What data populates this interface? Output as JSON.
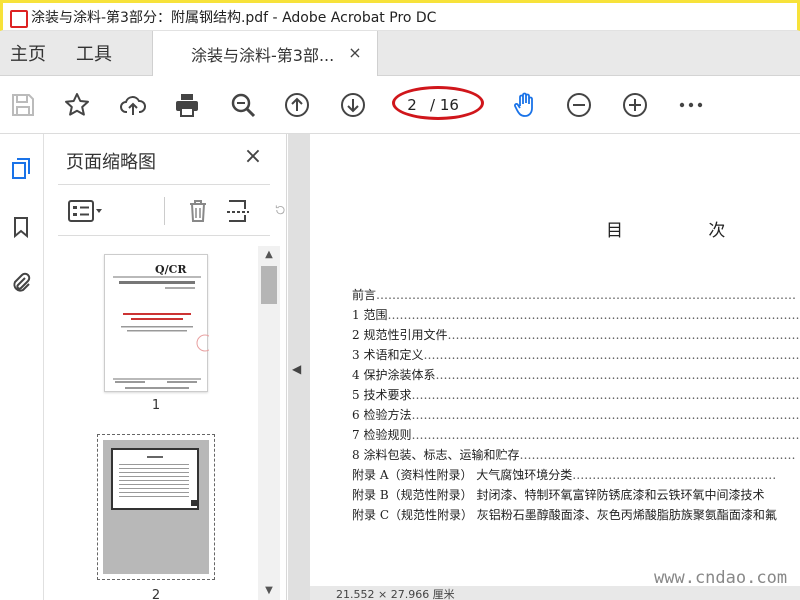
{
  "window": {
    "title": "涂装与涂料-第3部分：附属钢结构.pdf - Adobe Acrobat Pro DC"
  },
  "menu": {
    "home": "主页",
    "tools": "工具"
  },
  "tab": {
    "label": "涂装与涂料-第3部...",
    "close": "×"
  },
  "toolbar": {
    "page_current": "2",
    "page_total": "/ 16",
    "hand_color": "#1a73e8"
  },
  "panel": {
    "title": "页面缩略图",
    "close": "×",
    "thumb1_label": "1",
    "thumb2_label": "2",
    "thumb1_header": "Q/CR"
  },
  "document": {
    "toc_title": "目 次",
    "toc": [
      {
        "label": "前言",
        "dots": "……………………………………………………………………………………………"
      },
      {
        "label": "1   范围",
        "dots": "……………………………………………………………………………………………"
      },
      {
        "label": "2   规范性引用文件",
        "dots": "…………………………………………………………………………………"
      },
      {
        "label": "3   术语和定义",
        "dots": "………………………………………………………………………………………"
      },
      {
        "label": "4   保护涂装体系",
        "dots": "……………………………………………………………………………………"
      },
      {
        "label": "5   技术要求",
        "dots": "…………………………………………………………………………………………"
      },
      {
        "label": "6   检验方法",
        "dots": "…………………………………………………………………………………………"
      },
      {
        "label": "7   检验规则",
        "dots": "…………………………………………………………………………………………"
      },
      {
        "label": "8   涂料包装、标志、运输和贮存",
        "dots": "……………………………………………………………"
      },
      {
        "label": "附录 A（资料性附录）   大气腐蚀环境分类",
        "dots": "……………………………………………"
      },
      {
        "label": "附录 B（规范性附录）   封闭漆、特制环氧富锌防锈底漆和云铁环氧中间漆技术",
        "dots": ""
      },
      {
        "label": "附录 C（规范性附录）   灰铝粉石墨醇酸面漆、灰色丙烯酸脂肪族聚氨酯面漆和氟",
        "dots": ""
      }
    ],
    "status": "21.552 × 27.966 厘米"
  },
  "watermark": "www.cndao.com"
}
